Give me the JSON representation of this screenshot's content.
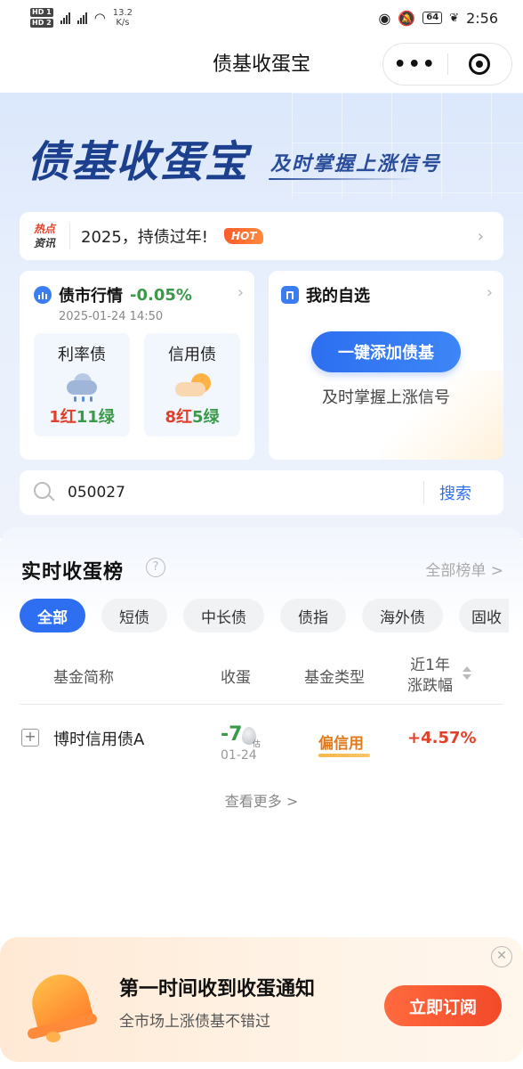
{
  "status_bar": {
    "net_speed": "13.2",
    "net_unit": "K/s",
    "battery": "64",
    "time": "2:56",
    "sim1": "HD 1",
    "sim2": "HD 2"
  },
  "nav": {
    "title": "债基收蛋宝",
    "more_label": "•••"
  },
  "hero": {
    "brand": "债基收蛋宝",
    "slogan": "及时掌握上涨信号"
  },
  "news": {
    "tag_line1": "热点",
    "tag_line2": "资讯",
    "text": "2025，持债过年!",
    "badge": "HOT"
  },
  "market": {
    "title": "债市行情",
    "change": "-0.05%",
    "time": "2025-01-24 14:50",
    "boxes": [
      {
        "name": "利率债",
        "icon": "rain-cloud-icon",
        "red": "1红",
        "green": "11绿"
      },
      {
        "name": "信用债",
        "icon": "sun-cloud-icon",
        "red": "8红",
        "green": "5绿"
      }
    ]
  },
  "watchlist": {
    "title": "我的自选",
    "button": "一键添加债基",
    "subtitle": "及时掌握上涨信号"
  },
  "search": {
    "value": "050027",
    "button": "搜索"
  },
  "ranking": {
    "title": "实时收蛋榜",
    "all_link": "全部榜单 >",
    "tabs": [
      "全部",
      "短债",
      "中长债",
      "债指",
      "海外债",
      "固收"
    ],
    "active_tab": "全部",
    "columns": {
      "name": "基金简称",
      "egg": "收蛋",
      "type": "基金类型",
      "change_l1": "近1年",
      "change_l2": "涨跌幅"
    },
    "rows": [
      {
        "name": "博时信用债A",
        "egg": "-7",
        "egg_badge": "估",
        "date": "01-24",
        "type": "偏信用",
        "change": "+4.57%"
      }
    ],
    "view_more": "查看更多 >"
  },
  "subscribe": {
    "title": "第一时间收到收蛋通知",
    "desc": "全市场上涨债基不错过",
    "button": "立即订阅"
  },
  "colors": {
    "accent": "#2d6ff0",
    "up": "#e0412a",
    "down": "#3a9a4a",
    "brand": "#1c3f8e"
  }
}
